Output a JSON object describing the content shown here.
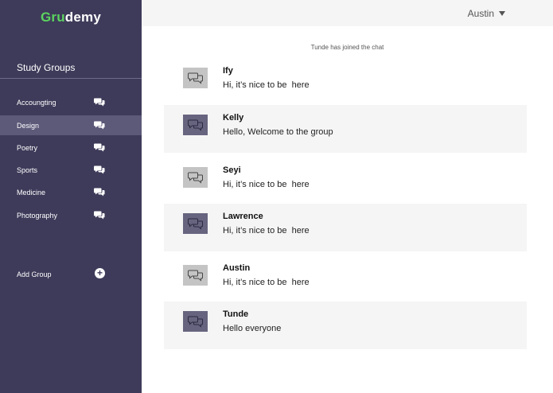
{
  "app": {
    "logo_accent": "Gru",
    "logo_rest": "demy"
  },
  "sidebar": {
    "title": "Study Groups",
    "items": [
      {
        "label": "Accoungting",
        "active": false
      },
      {
        "label": "Design",
        "active": true
      },
      {
        "label": "Poetry",
        "active": false
      },
      {
        "label": "Sports",
        "active": false
      },
      {
        "label": "Medicine",
        "active": false
      },
      {
        "label": "Photography",
        "active": false
      }
    ],
    "add_group_label": "Add Group",
    "item_icon": "chat-bubbles-icon",
    "add_icon": "plus-circle-icon"
  },
  "header": {
    "user_name": "Austin"
  },
  "chat": {
    "system_message": "Tunde has joined the chat",
    "messages": [
      {
        "name": "Ify",
        "text": "Hi, it’s nice to be  here",
        "avatar_icon": "chat-bubbles-icon"
      },
      {
        "name": "Kelly",
        "text": "Hello, Welcome to the group",
        "avatar_icon": "chat-bubbles-icon"
      },
      {
        "name": "Seyi",
        "text": "Hi, it’s nice to be  here",
        "avatar_icon": "chat-bubbles-icon"
      },
      {
        "name": "Lawrence",
        "text": "Hi, it’s nice to be  here",
        "avatar_icon": "chat-bubbles-icon"
      },
      {
        "name": "Austin",
        "text": "Hi, it’s nice to be  here",
        "avatar_icon": "chat-bubbles-icon"
      },
      {
        "name": "Tunde",
        "text": "Hello everyone",
        "avatar_icon": "chat-bubbles-icon"
      }
    ]
  },
  "colors": {
    "sidebar_bg": "#3e3b5a",
    "sidebar_active": "#5c5979",
    "brand_accent": "#5bd35f",
    "shaded_row": "#f5f5f5"
  }
}
